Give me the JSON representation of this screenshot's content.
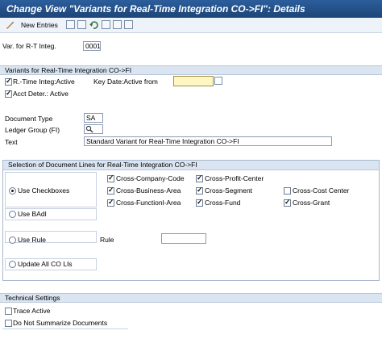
{
  "title": "Change View \"Variants for Real-Time Integration CO->FI\": Details",
  "toolbar": {
    "new_entries": "New Entries"
  },
  "header": {
    "var_label": "Var. for R-T Integ.",
    "var_value": "0001"
  },
  "variants_section": {
    "title": "Variants for Real-Time Integration CO->FI",
    "rt_integ_active": "R.-Time Integ:Active",
    "key_date_label": "Key Date:Active from",
    "key_date_value": "",
    "acct_deter_active": "Acct Deter.: Active",
    "document_type_label": "Document Type",
    "document_type_value": "SA",
    "ledger_group_label": "Ledger Group (FI)",
    "ledger_group_value": "",
    "text_label": "Text",
    "text_value": "Standard Variant for Real-Time Integration CO->FI"
  },
  "selection_section": {
    "title": "Selection of Document Lines for Real-Time Integration CO->FI",
    "use_checkboxes": "Use Checkboxes",
    "use_badi": "Use BAdI",
    "use_rule": "Use Rule",
    "rule_label": "Rule",
    "rule_value": "",
    "update_all": "Update All CO LIs",
    "checks": {
      "cross_company_code": "Cross-Company-Code",
      "cross_profit_center": "Cross-Profit-Center",
      "cross_business_area": "Cross-Business-Area",
      "cross_segment": "Cross-Segment",
      "cross_cost_center": "Cross-Cost Center",
      "cross_functional_area": "Cross-Functionl-Area",
      "cross_fund": "Cross-Fund",
      "cross_grant": "Cross-Grant"
    }
  },
  "technical_section": {
    "title": "Technical Settings",
    "trace_active": "Trace Active",
    "do_not_summarize": "Do Not Summarize Documents"
  },
  "colors": {
    "titlebar": "#22508a",
    "section_header": "#dbe5f1",
    "required_field": "#fff7c2"
  }
}
